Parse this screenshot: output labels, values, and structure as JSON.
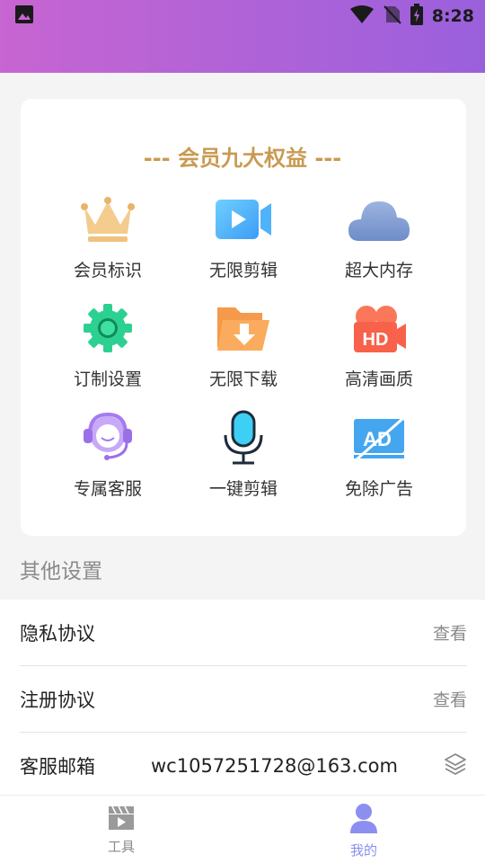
{
  "status_bar": {
    "time": "8:28",
    "icons": [
      "image-icon",
      "wifi-icon",
      "no-sim-icon",
      "battery-charging-icon"
    ]
  },
  "benefits_card": {
    "title": "--- 会员九大权益 ---",
    "items": [
      {
        "label": "会员标识",
        "icon": "crown-icon"
      },
      {
        "label": "无限剪辑",
        "icon": "video-camera-icon"
      },
      {
        "label": "超大内存",
        "icon": "cloud-icon"
      },
      {
        "label": "订制设置",
        "icon": "gear-icon"
      },
      {
        "label": "无限下载",
        "icon": "download-folder-icon"
      },
      {
        "label": "高清画质",
        "icon": "hd-camera-icon"
      },
      {
        "label": "专属客服",
        "icon": "customer-service-icon"
      },
      {
        "label": "一键剪辑",
        "icon": "microphone-icon"
      },
      {
        "label": "免除广告",
        "icon": "no-ad-icon"
      }
    ]
  },
  "other_settings": {
    "title": "其他设置",
    "privacy": {
      "label": "隐私协议",
      "action": "查看"
    },
    "register": {
      "label": "注册协议",
      "action": "查看"
    },
    "email": {
      "label": "客服邮箱",
      "value": "wc1057251728@163.com",
      "icon": "layers-icon"
    }
  },
  "tabbar": {
    "tools": {
      "label": "工具",
      "icon": "clapperboard-icon"
    },
    "mine": {
      "label": "我的",
      "icon": "user-icon"
    }
  },
  "colors": {
    "header_start": "#c765d2",
    "header_end": "#9a60dc",
    "gold": "#c99a52",
    "active_tab": "#8c8ef0",
    "inactive_tab": "#8a8a8a"
  }
}
